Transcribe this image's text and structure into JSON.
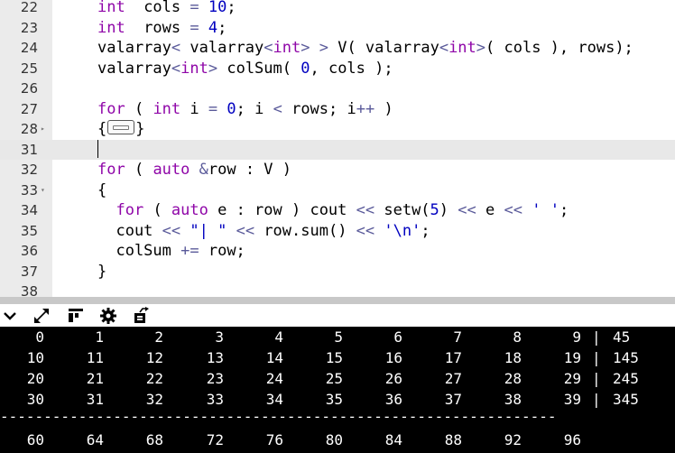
{
  "editor": {
    "lines": [
      {
        "num": "22",
        "fold": "",
        "parts": [
          [
            "kw",
            "int"
          ],
          [
            "",
            "  cols "
          ],
          [
            "op",
            "="
          ],
          [
            "",
            ""
          ],
          [
            "num",
            " 10"
          ],
          [
            "",
            ";"
          ]
        ]
      },
      {
        "num": "23",
        "fold": "",
        "parts": [
          [
            "kw",
            "int"
          ],
          [
            "",
            "  rows "
          ],
          [
            "op",
            "="
          ],
          [
            "num",
            " 4"
          ],
          [
            "",
            ";"
          ]
        ]
      },
      {
        "num": "24",
        "fold": "",
        "parts": [
          [
            "",
            "valarray"
          ],
          [
            "op",
            "<"
          ],
          [
            "",
            " valarray"
          ],
          [
            "op",
            "<"
          ],
          [
            "kw",
            "int"
          ],
          [
            "op",
            ">"
          ],
          [
            "",
            " "
          ],
          [
            "op",
            ">"
          ],
          [
            "",
            " V( valarray"
          ],
          [
            "op",
            "<"
          ],
          [
            "kw",
            "int"
          ],
          [
            "op",
            ">"
          ],
          [
            "",
            "( cols ), rows);"
          ]
        ]
      },
      {
        "num": "25",
        "fold": "",
        "parts": [
          [
            "",
            "valarray"
          ],
          [
            "op",
            "<"
          ],
          [
            "kw",
            "int"
          ],
          [
            "op",
            ">"
          ],
          [
            "",
            " colSum( "
          ],
          [
            "num",
            "0"
          ],
          [
            "",
            ", cols );"
          ]
        ]
      },
      {
        "num": "26",
        "fold": "",
        "parts": []
      },
      {
        "num": "27",
        "fold": "",
        "parts": [
          [
            "kw",
            "for"
          ],
          [
            "",
            " ( "
          ],
          [
            "kw",
            "int"
          ],
          [
            "",
            " i "
          ],
          [
            "op",
            "="
          ],
          [
            "",
            " "
          ],
          [
            "num",
            "0"
          ],
          [
            "",
            ";"
          ],
          [
            "",
            " i "
          ],
          [
            "op",
            "<"
          ],
          [
            "",
            " rows; i"
          ],
          [
            "op",
            "++"
          ],
          [
            "",
            " )"
          ]
        ]
      },
      {
        "num": "28",
        "fold": "▸",
        "parts": [
          [
            "",
            "{"
          ],
          [
            "box",
            ""
          ],
          [
            "",
            "}"
          ]
        ]
      },
      {
        "num": "31",
        "fold": "",
        "parts": [],
        "active": true
      },
      {
        "num": "32",
        "fold": "",
        "parts": [
          [
            "kw",
            "for"
          ],
          [
            "",
            " ( "
          ],
          [
            "kw",
            "auto"
          ],
          [
            "",
            " "
          ],
          [
            "op",
            "&"
          ],
          [
            "",
            "row : V )"
          ]
        ]
      },
      {
        "num": "33",
        "fold": "▾",
        "parts": [
          [
            "",
            "{"
          ]
        ]
      },
      {
        "num": "34",
        "fold": "",
        "parts": [
          [
            "",
            "  "
          ],
          [
            "kw",
            "for"
          ],
          [
            "",
            " ( "
          ],
          [
            "kw",
            "auto"
          ],
          [
            "",
            " e : row ) cout "
          ],
          [
            "op",
            "<<"
          ],
          [
            "",
            " setw("
          ],
          [
            "num",
            "5"
          ],
          [
            "",
            ") "
          ],
          [
            "op",
            "<<"
          ],
          [
            "",
            " e "
          ],
          [
            "op",
            "<<"
          ],
          [
            "",
            " "
          ],
          [
            "str",
            "' '"
          ],
          [
            "",
            ";"
          ]
        ]
      },
      {
        "num": "35",
        "fold": "",
        "parts": [
          [
            "",
            "  cout "
          ],
          [
            "op",
            "<<"
          ],
          [
            "",
            " "
          ],
          [
            "str",
            "\"| \""
          ],
          [
            "",
            " "
          ],
          [
            "op",
            "<<"
          ],
          [
            "",
            " row.sum() "
          ],
          [
            "op",
            "<<"
          ],
          [
            "",
            " "
          ],
          [
            "str",
            "'\\n'"
          ],
          [
            "",
            ";"
          ]
        ]
      },
      {
        "num": "36",
        "fold": "",
        "parts": [
          [
            "",
            "  colSum "
          ],
          [
            "op",
            "+="
          ],
          [
            "",
            " row;"
          ]
        ]
      },
      {
        "num": "37",
        "fold": "",
        "parts": [
          [
            "",
            "}"
          ]
        ]
      },
      {
        "num": "38",
        "fold": "",
        "parts": []
      }
    ]
  },
  "toolbar": {
    "icons": [
      "chevron-down-icon",
      "resize-icon",
      "layout-icon",
      "gear-icon",
      "export-icon"
    ]
  },
  "console": {
    "rows": [
      {
        "values": [
          "0",
          "1",
          "2",
          "3",
          "4",
          "5",
          "6",
          "7",
          "8",
          "9"
        ],
        "sep": "|",
        "sum": "45"
      },
      {
        "values": [
          "10",
          "11",
          "12",
          "13",
          "14",
          "15",
          "16",
          "17",
          "18",
          "19"
        ],
        "sep": "|",
        "sum": "145"
      },
      {
        "values": [
          "20",
          "21",
          "22",
          "23",
          "24",
          "25",
          "26",
          "27",
          "28",
          "29"
        ],
        "sep": "|",
        "sum": "245"
      },
      {
        "values": [
          "30",
          "31",
          "32",
          "33",
          "34",
          "35",
          "36",
          "37",
          "38",
          "39"
        ],
        "sep": "|",
        "sum": "345"
      }
    ],
    "divider": "----------------------------------------------------------------",
    "colsums": [
      "60",
      "64",
      "68",
      "72",
      "76",
      "80",
      "84",
      "88",
      "92",
      "96"
    ]
  }
}
